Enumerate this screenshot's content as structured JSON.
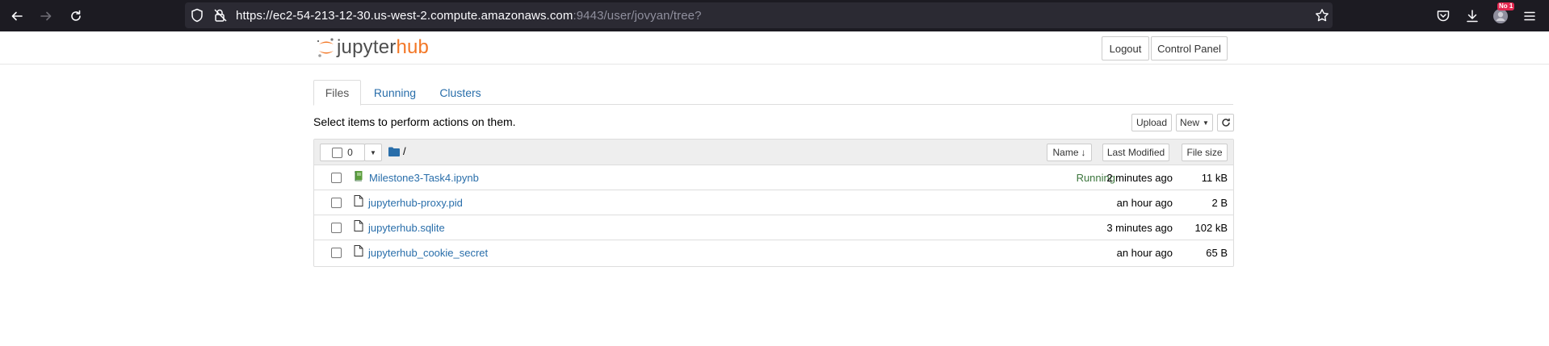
{
  "browser": {
    "url_host": "https://ec2-54-213-12-30.us-west-2.compute.amazonaws.com",
    "url_rest": ":9443/user/jovyan/tree?",
    "badge": "No 1"
  },
  "header": {
    "logo_jupyter": "jupyter",
    "logo_hub": "hub",
    "logout_label": "Logout",
    "control_panel_label": "Control Panel"
  },
  "tabs": [
    {
      "label": "Files",
      "active": true
    },
    {
      "label": "Running",
      "active": false
    },
    {
      "label": "Clusters",
      "active": false
    }
  ],
  "toolbar": {
    "instruction": "Select items to perform actions on them.",
    "upload_label": "Upload",
    "new_label": "New"
  },
  "list_header": {
    "selected_count": "0",
    "path": "/",
    "name_label": "Name",
    "last_modified_label": "Last Modified",
    "file_size_label": "File size"
  },
  "files": [
    {
      "name": "Milestone3-Task4.ipynb",
      "type": "notebook",
      "status": "Running",
      "modified": "2 minutes ago",
      "size": "11 kB"
    },
    {
      "name": "jupyterhub-proxy.pid",
      "type": "file",
      "status": "",
      "modified": "an hour ago",
      "size": "2 B"
    },
    {
      "name": "jupyterhub.sqlite",
      "type": "file",
      "status": "",
      "modified": "3 minutes ago",
      "size": "102 kB"
    },
    {
      "name": "jupyterhub_cookie_secret",
      "type": "file",
      "status": "",
      "modified": "an hour ago",
      "size": "65 B"
    }
  ],
  "colors": {
    "link": "#296eaa",
    "running": "#3c763d",
    "brand_orange": "#f37726",
    "chrome_bg": "#1c1b22"
  }
}
